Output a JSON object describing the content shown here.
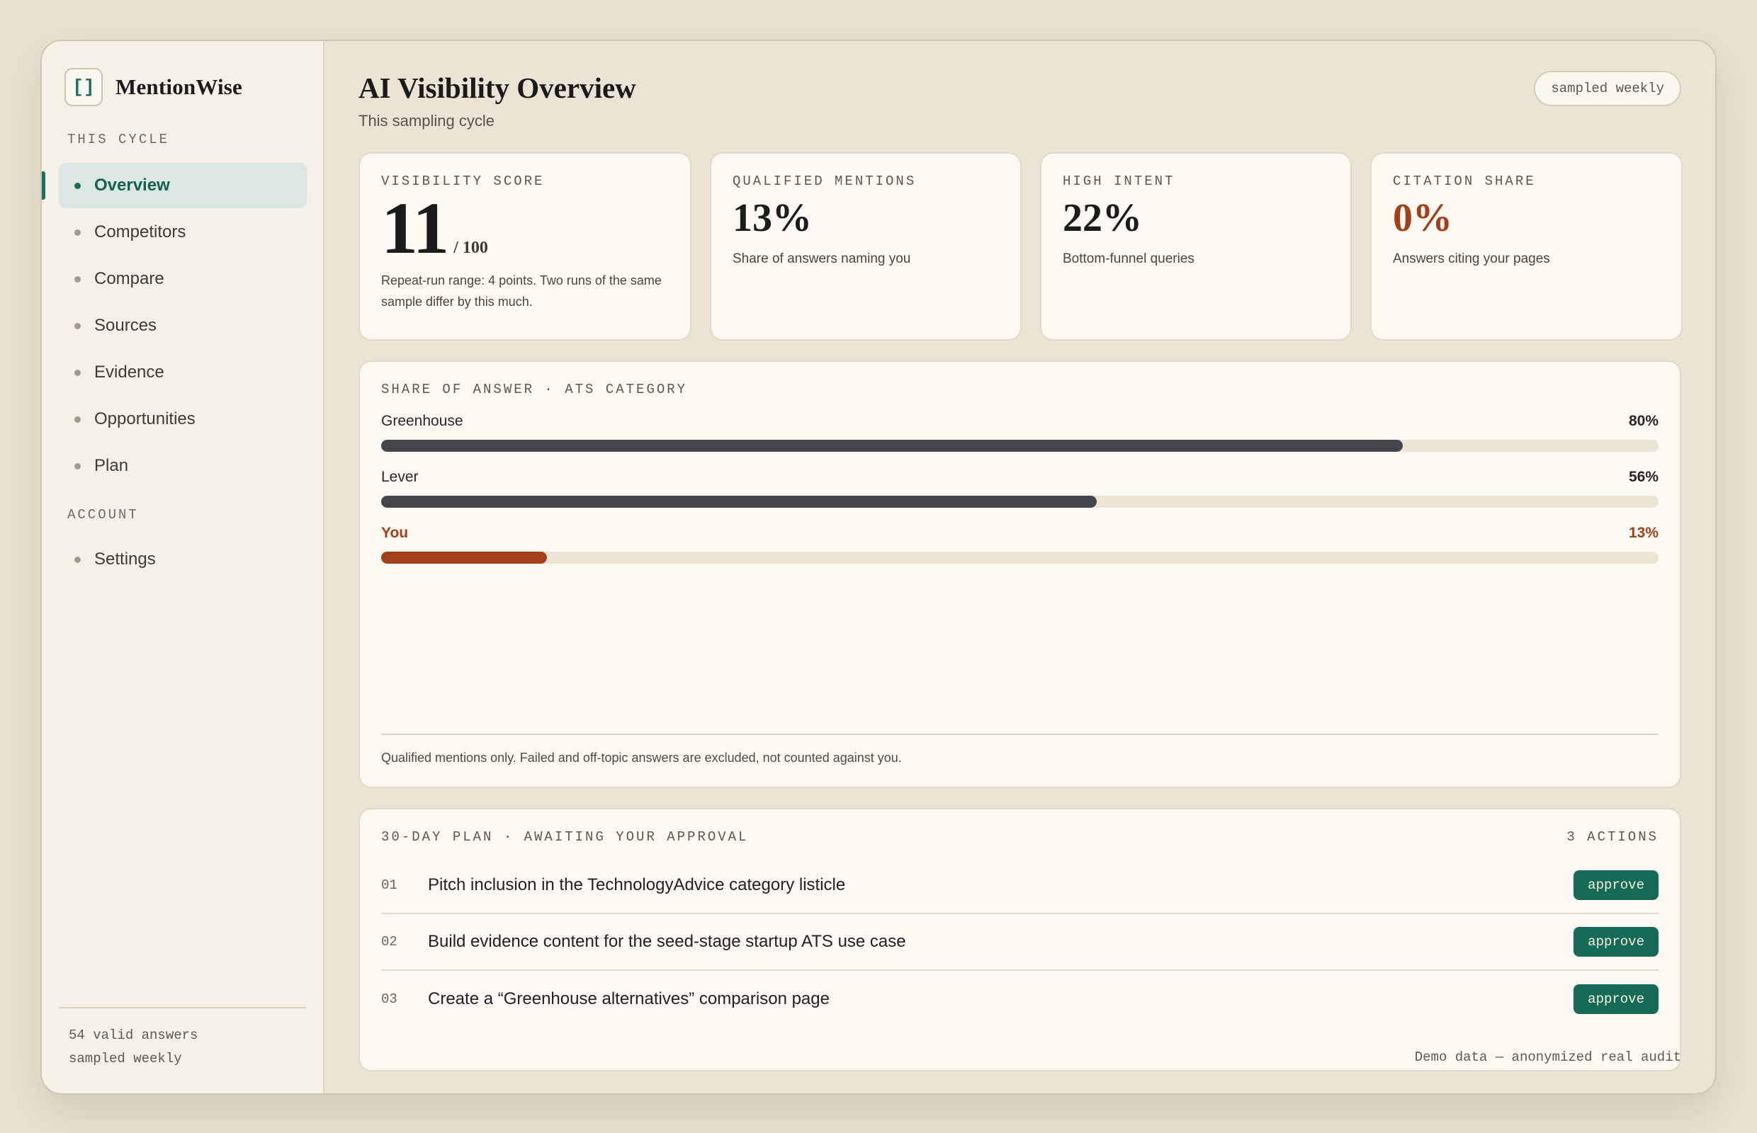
{
  "brand": {
    "mark": "[]",
    "name": "MentionWise"
  },
  "sidebar": {
    "section_cycle": "THIS CYCLE",
    "items": [
      {
        "label": "Overview",
        "active": true
      },
      {
        "label": "Competitors"
      },
      {
        "label": "Compare"
      },
      {
        "label": "Sources"
      },
      {
        "label": "Evidence"
      },
      {
        "label": "Opportunities"
      },
      {
        "label": "Plan"
      }
    ],
    "section_account": "ACCOUNT",
    "account_items": [
      {
        "label": "Settings"
      }
    ],
    "footer_line1": "54 valid answers",
    "footer_line2": "sampled weekly"
  },
  "header": {
    "title": "AI Visibility Overview",
    "subtitle": "This sampling cycle",
    "pill": "sampled weekly"
  },
  "metrics": {
    "visibility": {
      "label": "VISIBILITY SCORE",
      "value": "11",
      "denominator": "/ 100",
      "desc": "Repeat-run range: 4 points. Two runs of the same sample differ by this much."
    },
    "qualified": {
      "label": "QUALIFIED MENTIONS",
      "value": "13%",
      "desc": "Share of answers naming you"
    },
    "intent": {
      "label": "HIGH INTENT",
      "value": "22%",
      "desc": "Bottom-funnel queries"
    },
    "citation": {
      "label": "CITATION SHARE",
      "value": "0%",
      "desc": "Answers citing your pages"
    }
  },
  "share_of_answer": {
    "title": "SHARE OF ANSWER · ATS CATEGORY",
    "footnote": "Qualified mentions only. Failed and off-topic answers are excluded, not counted against you."
  },
  "chart_data": {
    "type": "bar",
    "title": "SHARE OF ANSWER · ATS CATEGORY",
    "categories": [
      "Greenhouse",
      "Lever",
      "You"
    ],
    "values": [
      80,
      56,
      13
    ],
    "labels": [
      "80%",
      "56%",
      "13%"
    ],
    "ylim": [
      0,
      100
    ],
    "colors": {
      "default": "#44464b",
      "you": "#a3401a"
    }
  },
  "plan": {
    "title": "30-DAY PLAN · AWAITING YOUR APPROVAL",
    "count": "3 ACTIONS",
    "items": [
      {
        "num": "01",
        "text": "Pitch inclusion in the TechnologyAdvice category listicle",
        "action": "approve"
      },
      {
        "num": "02",
        "text": "Build evidence content for the seed-stage startup ATS use case",
        "action": "approve"
      },
      {
        "num": "03",
        "text": "Create a “Greenhouse alternatives” comparison page",
        "action": "approve"
      }
    ]
  },
  "footnote": "Demo data — anonymized real audit",
  "colors": {
    "accent": "#166b57",
    "warning": "#a3401a",
    "background": "#e9e2d2"
  }
}
